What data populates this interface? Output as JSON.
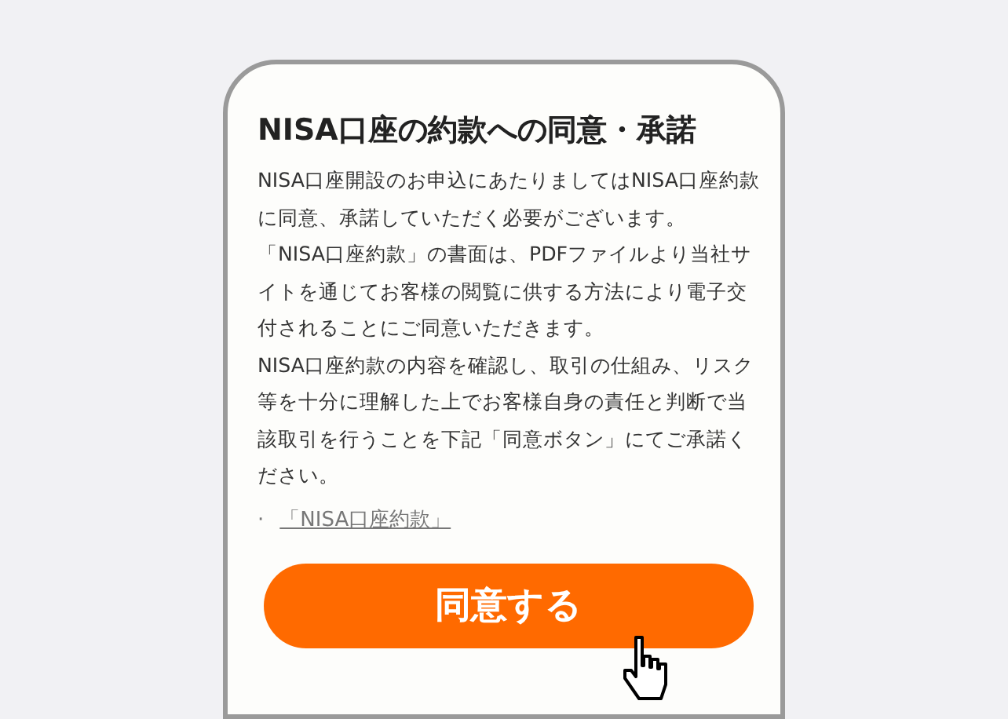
{
  "title": "NISA口座の約款への同意・承諾",
  "paragraphs": [
    "NISA口座開設のお申込にあたりましてはNISA口座約款に同意、承諾していただく必要がございます。",
    "「NISA口座約款」の書面は、PDFファイルより当社サイトを通じてお客様の閲覧に供する方法により電子交付されることにご同意いただきます。",
    "NISA口座約款の内容を確認し、取引の仕組み、リスク等を十分に理解した上でお客様自身の責任と判断で当該取引を行うことを下記「同意ボタン」にてご承諾ください。"
  ],
  "links": [
    {
      "bullet": "·",
      "label": "「NISA口座約款」"
    }
  ],
  "button": {
    "label": "同意する"
  }
}
